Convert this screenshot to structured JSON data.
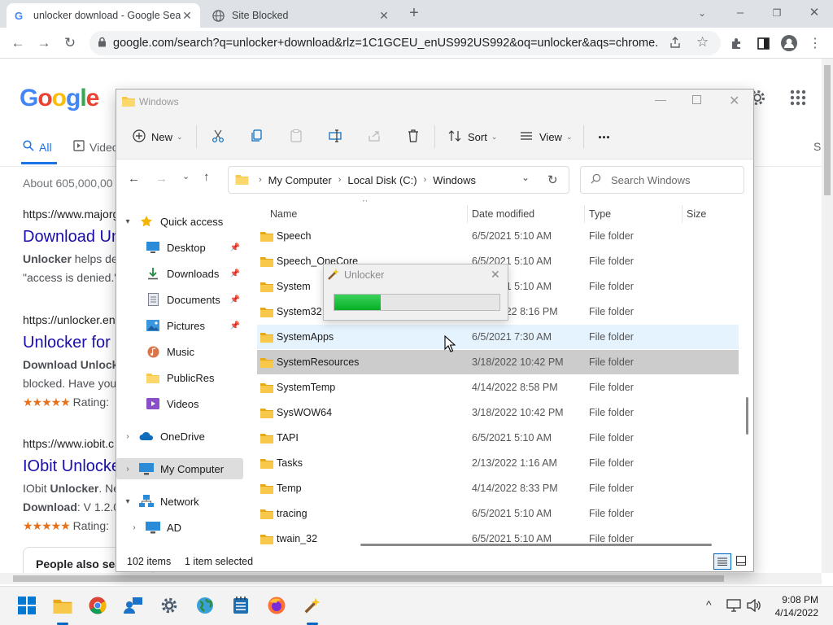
{
  "browser": {
    "tabs": [
      {
        "title": "unlocker download - Google Search",
        "icon": "google-g-icon"
      },
      {
        "title": "Site Blocked",
        "icon": "globe-icon"
      }
    ],
    "url": "google.com/search?q=unlocker+download&rlz=1C1GCEU_enUS992US992&oq=unlocker&aqs=chrome.0.6..."
  },
  "google": {
    "logo": "Google",
    "tab_all": "All",
    "tab_videos": "Videos",
    "tab_right": "S",
    "about": "About 605,000,00",
    "results": [
      {
        "url": "https://www.majorg",
        "title": "Download Un",
        "line1_bold": "Unlocker",
        "line1_rest": " helps de",
        "line2": "\"access is denied.\""
      },
      {
        "url": "https://unlocker.en",
        "title": "Unlocker for",
        "line1_bold": "Download Unlocke",
        "line2": "blocked. Have you",
        "stars": "★★★★★",
        "rating": "Rating:"
      },
      {
        "url": "https://www.iobit.c",
        "title": "IObit Unlocke",
        "line1_plain": "IObit ",
        "line1_bold": "Unlocker",
        "line1_rest": ". Ne",
        "line2_bold": "Download",
        "line2_rest": ": V 1.2.0",
        "stars": "★★★★★",
        "rating": "Rating:"
      }
    ],
    "people_also": "People also sea"
  },
  "explorer": {
    "title": "Windows",
    "commands": {
      "new": "New",
      "sort": "Sort",
      "view": "View",
      "more": "..."
    },
    "breadcrumb": [
      "My Computer",
      "Local Disk (C:)",
      "Windows"
    ],
    "search_placeholder": "Search Windows",
    "nav": [
      {
        "label": "Quick access",
        "icon": "star-icon"
      },
      {
        "label": "Desktop",
        "icon": "desktop-icon"
      },
      {
        "label": "Downloads",
        "icon": "download-icon"
      },
      {
        "label": "Documents",
        "icon": "document-icon"
      },
      {
        "label": "Pictures",
        "icon": "pictures-icon"
      },
      {
        "label": "Music",
        "icon": "music-icon"
      },
      {
        "label": "PublicRes",
        "icon": "folder-icon"
      },
      {
        "label": "Videos",
        "icon": "video-icon"
      },
      {
        "label": "OneDrive",
        "icon": "cloud-icon"
      },
      {
        "label": "My Computer",
        "icon": "computer-icon"
      },
      {
        "label": "Network",
        "icon": "network-icon"
      },
      {
        "label": "AD",
        "icon": "computer-icon"
      }
    ],
    "columns": {
      "name": "Name",
      "date": "Date modified",
      "type": "Type",
      "size": "Size"
    },
    "files": [
      {
        "name": "Speech",
        "date": "6/5/2021 5:10 AM",
        "type": "File folder"
      },
      {
        "name": "Speech_OneCore",
        "date": "6/5/2021 5:10 AM",
        "type": "File folder"
      },
      {
        "name": "System",
        "date": "6/5/2021 5:10 AM",
        "type": "File folder"
      },
      {
        "name": "System32",
        "date": "4/14/2022 8:16 PM",
        "type": "File folder"
      },
      {
        "name": "SystemApps",
        "date": "6/5/2021 7:30 AM",
        "type": "File folder"
      },
      {
        "name": "SystemResources",
        "date": "3/18/2022 10:42 PM",
        "type": "File folder"
      },
      {
        "name": "SystemTemp",
        "date": "4/14/2022 8:58 PM",
        "type": "File folder"
      },
      {
        "name": "SysWOW64",
        "date": "3/18/2022 10:42 PM",
        "type": "File folder"
      },
      {
        "name": "TAPI",
        "date": "6/5/2021 5:10 AM",
        "type": "File folder"
      },
      {
        "name": "Tasks",
        "date": "2/13/2022 1:16 AM",
        "type": "File folder"
      },
      {
        "name": "Temp",
        "date": "4/14/2022 8:33 PM",
        "type": "File folder"
      },
      {
        "name": "tracing",
        "date": "6/5/2021 5:10 AM",
        "type": "File folder"
      },
      {
        "name": "twain_32",
        "date": "6/5/2021 5:10 AM",
        "type": "File folder"
      }
    ],
    "status_items": "102 items",
    "status_selected": "1 item selected"
  },
  "unlocker": {
    "title": "Unlocker",
    "progress_percent": 28
  },
  "taskbar": {
    "time": "9:08 PM",
    "date": "4/14/2022"
  },
  "colors": {
    "google_blue": "#4285f4",
    "google_red": "#ea4335",
    "google_yellow": "#fbbc05",
    "google_green": "#34a853",
    "link": "#1a0dab",
    "folder": "#f8c84b",
    "progress": "#06b025"
  }
}
